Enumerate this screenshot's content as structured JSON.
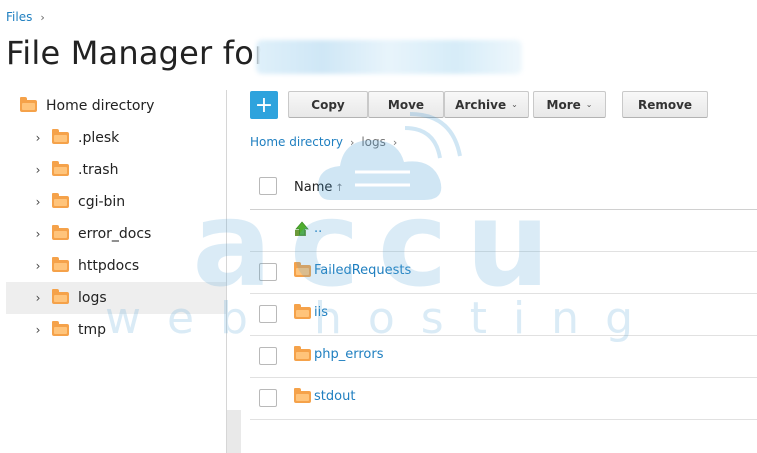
{
  "breadcrumb": {
    "root": "Files",
    "sep": "›"
  },
  "header": {
    "title": "File Manager for"
  },
  "tree": {
    "root_label": "Home directory",
    "items": [
      {
        "label": ".plesk"
      },
      {
        "label": ".trash"
      },
      {
        "label": "cgi-bin"
      },
      {
        "label": "error_docs"
      },
      {
        "label": "httpdocs"
      },
      {
        "label": "logs",
        "selected": true
      },
      {
        "label": "tmp"
      }
    ]
  },
  "toolbar": {
    "add_icon": "+",
    "copy": "Copy",
    "move": "Move",
    "archive": "Archive",
    "more": "More",
    "remove": "Remove",
    "caret": "⌄"
  },
  "path": {
    "home": "Home directory",
    "current": "logs",
    "sep": "›"
  },
  "table": {
    "column_name": "Name",
    "sort_arrow": "↑",
    "rows": [
      {
        "name": "..",
        "type": "parent"
      },
      {
        "name": "FailedRequests",
        "type": "folder"
      },
      {
        "name": "iis",
        "type": "folder"
      },
      {
        "name": "php_errors",
        "type": "folder"
      },
      {
        "name": "stdout",
        "type": "folder"
      }
    ]
  },
  "watermark": {
    "brand": "accu",
    "sub": "web hosting"
  },
  "colors": {
    "accent": "#2ea3dd",
    "link": "#1f7fc0",
    "folder": "#f5a24a"
  }
}
